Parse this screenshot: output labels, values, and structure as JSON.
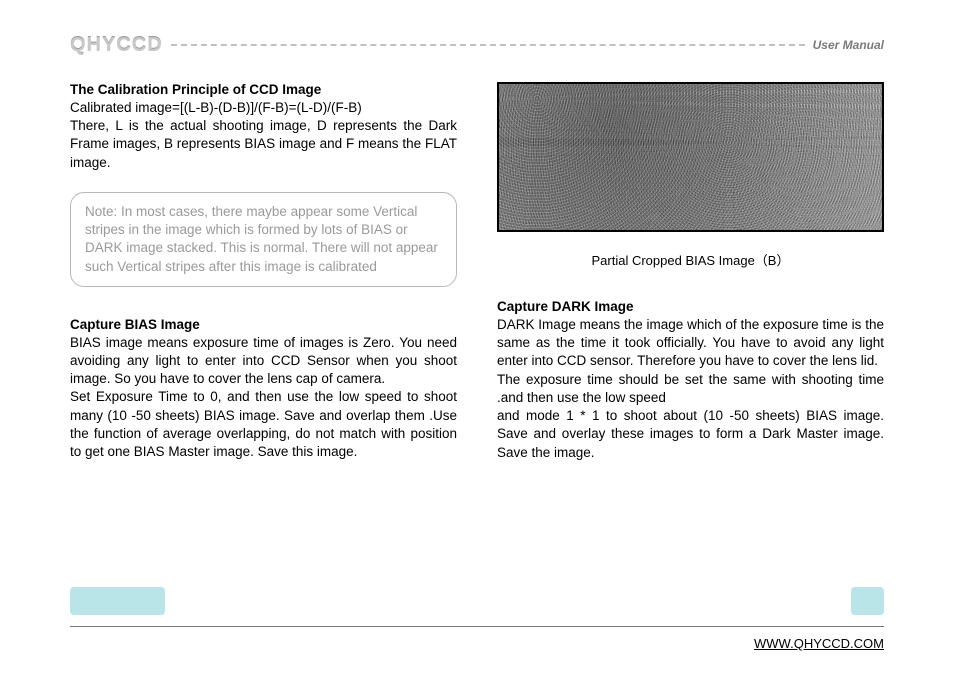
{
  "header": {
    "logo": "QHYCCD",
    "manual_label": "User Manual"
  },
  "left": {
    "calib_heading": "The Calibration Principle of CCD Image",
    "calib_formula": "Calibrated image=[(L-B)-(D-B)]/(F-B)=(L-D)/(F-B)",
    "calib_body": "There, L is the actual shooting image, D represents the Dark Frame images, B represents BIAS image and F means the FLAT image.",
    "note": "Note: In most cases, there maybe appear some Vertical stripes in the image which is formed by lots of BIAS or DARK image stacked. This is normal. There will not appear such Vertical stripes after this image is calibrated",
    "bias_heading": "Capture BIAS Image",
    "bias_p1": "BIAS image means exposure time of images is Zero. You need avoiding any light to enter into CCD Sensor when you shoot image. So you have to cover the lens cap of camera.",
    "bias_p2": "Set Exposure Time  to 0, and then use the low speed to shoot  many (10 -50 sheets) BIAS image. Save and overlap them .Use the function of average overlapping, do not match with position to get one BIAS Master image. Save this image."
  },
  "right": {
    "caption": "Partial Cropped BIAS Image（B）",
    "dark_heading": "Capture DARK Image",
    "dark_p1": "DARK Image means the image which of the exposure time is the same as the time it took officially. You have to avoid any light enter into CCD sensor. Therefore you have to cover the lens lid.",
    "dark_p2": "The exposure time should be set the same with shooting time .and then use the low speed",
    "dark_p3": "and mode 1 * 1 to shoot about (10 -50 sheets) BIAS image. Save and overlay these images to form a Dark Master image. Save the image."
  },
  "footer": {
    "url": "WWW.QHYCCD.COM"
  }
}
